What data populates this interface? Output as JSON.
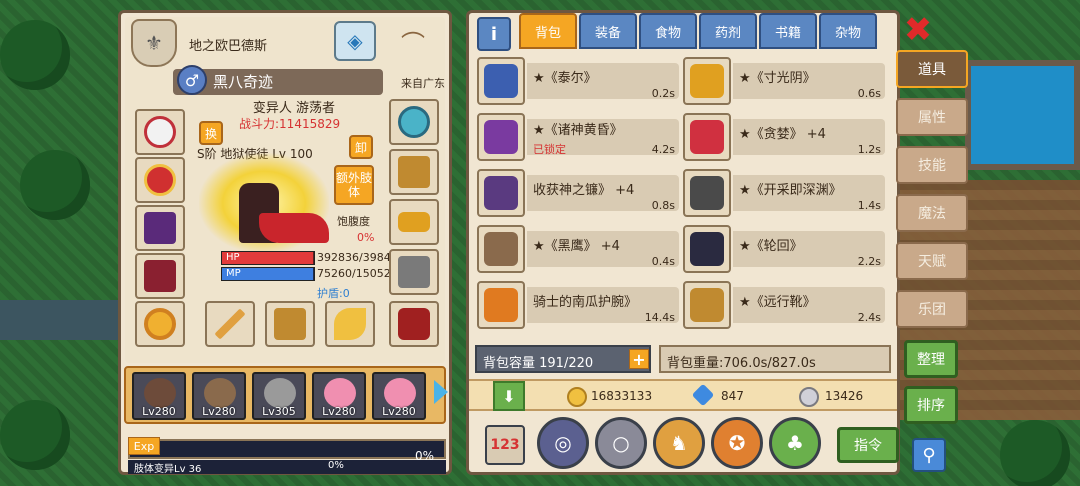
{
  "character": {
    "guild_name": "地之欧巴德斯",
    "gender_symbol": "♂",
    "name": "黑八奇迹",
    "from": "来自广东",
    "race_class": "变异人 游荡者",
    "power": "战斗力:11415829",
    "rank": "S阶 地狱使徒 Lv 100",
    "swap_label": "换",
    "unload_label": "卸",
    "extra_limb_label": "额外肢体",
    "hunger_label": "饱腹度",
    "hunger_value": "0%",
    "hp_tag": "HP",
    "mp_tag": "MP",
    "hp_value": "392836/3984",
    "mp_value": "75260/15052",
    "shield_value": "护盾:0",
    "hp_fraction": 0.99,
    "mp_fraction": 0.99
  },
  "heroes": [
    {
      "level": "Lv280",
      "color": "#6d4b3a"
    },
    {
      "level": "Lv280",
      "color": "#8a6a4c"
    },
    {
      "level": "Lv305",
      "color": "#9a9a9a"
    },
    {
      "level": "Lv280",
      "color": "#f08fb0"
    },
    {
      "level": "Lv280",
      "color": "#f08fb0"
    }
  ],
  "exp": {
    "tag": "Exp",
    "percent": "0%",
    "sub_label": "肢体变异Lv 36",
    "sub_percent": "0%"
  },
  "inventory": {
    "tabs": [
      "背包",
      "装备",
      "食物",
      "药剂",
      "书籍",
      "杂物"
    ],
    "active_tab": "背包",
    "items": [
      {
        "name": "★《泰尔》",
        "weight": "0.2s",
        "locked": "",
        "color": "#3c5fb0"
      },
      {
        "name": "★《寸光阴》",
        "weight": "0.6s",
        "locked": "",
        "color": "#e0a020"
      },
      {
        "name": "★《诸神黄昏》",
        "weight": "4.2s",
        "locked": "已锁定",
        "color": "#7a3aa0"
      },
      {
        "name": "★《贪婪》 +4",
        "weight": "1.2s",
        "locked": "",
        "color": "#d03040"
      },
      {
        "name": "收获神之镰》 +4",
        "weight": "0.8s",
        "locked": "",
        "color": "#5a3a80"
      },
      {
        "name": "★《开采即深渊》",
        "weight": "1.4s",
        "locked": "",
        "color": "#4a4a4a"
      },
      {
        "name": "★《黑鹰》 +4",
        "weight": "0.4s",
        "locked": "",
        "color": "#8a6a4c"
      },
      {
        "name": "★《轮回》",
        "weight": "2.2s",
        "locked": "",
        "color": "#2a2a40"
      },
      {
        "name": "骑士的南瓜护腕》",
        "weight": "14.4s",
        "locked": "",
        "color": "#e07a20"
      },
      {
        "name": "★《远行靴》",
        "weight": "2.4s",
        "locked": "",
        "color": "#c08a30"
      }
    ],
    "capacity": "背包容量 191/220",
    "weight": "背包重量:706.0s/827.0s",
    "gold": "16833133",
    "diamond": "847",
    "silver": "13426",
    "command_label": "指令",
    "sort123_label": "123"
  },
  "side_nav": {
    "items": [
      "道具",
      "属性",
      "技能",
      "魔法",
      "天赋",
      "乐团"
    ],
    "active": "道具",
    "organize_label": "整理",
    "sort_label": "排序"
  },
  "icons": {
    "close": "close-icon",
    "search": "search-icon",
    "info": "info-icon"
  }
}
